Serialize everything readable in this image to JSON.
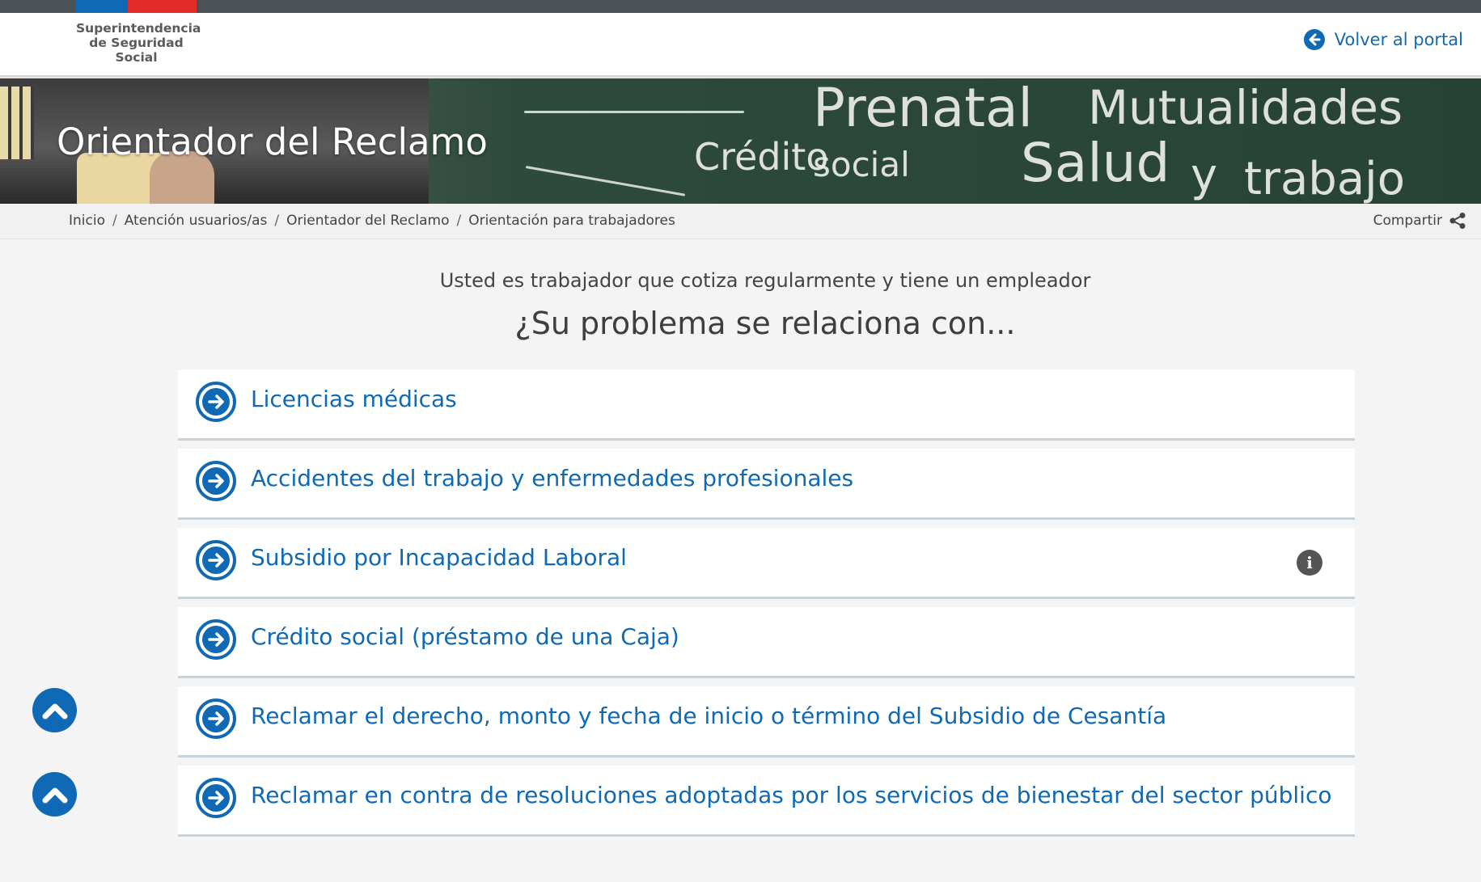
{
  "header": {
    "logo_lines": [
      "Superintendencia",
      "de Seguridad",
      "Social"
    ],
    "back_label": "Volver al portal"
  },
  "banner": {
    "title": "Orientador del Reclamo",
    "chalk_words": [
      "Prenatal",
      "Mutualidades",
      "Crédito",
      "social",
      "Salud",
      "y",
      "trabajo"
    ]
  },
  "breadcrumb": {
    "items": [
      "Inicio",
      "Atención usuarios/as",
      "Orientador del Reclamo",
      "Orientación para trabajadores"
    ],
    "separator": "/"
  },
  "share": {
    "label": "Compartir"
  },
  "main": {
    "subtitle": "Usted es trabajador que cotiza regularmente y tiene un empleador",
    "question": "¿Su problema se relaciona con...",
    "options": [
      {
        "label": "Licencias médicas"
      },
      {
        "label": "Accidentes del trabajo y enfermedades profesionales"
      },
      {
        "label": "Subsidio por Incapacidad Laboral",
        "info": "i"
      },
      {
        "label": "Crédito social (préstamo de una Caja)"
      },
      {
        "label": "Reclamar el derecho, monto y fecha de inicio o término del Subsidio de Cesantía"
      },
      {
        "label": "Reclamar en contra de resoluciones adoptadas por los servicios de bienestar del sector público"
      }
    ]
  },
  "colors": {
    "accent": "#0f69b4",
    "topbar": "#4a5257",
    "flag_red": "#e22c2c"
  }
}
